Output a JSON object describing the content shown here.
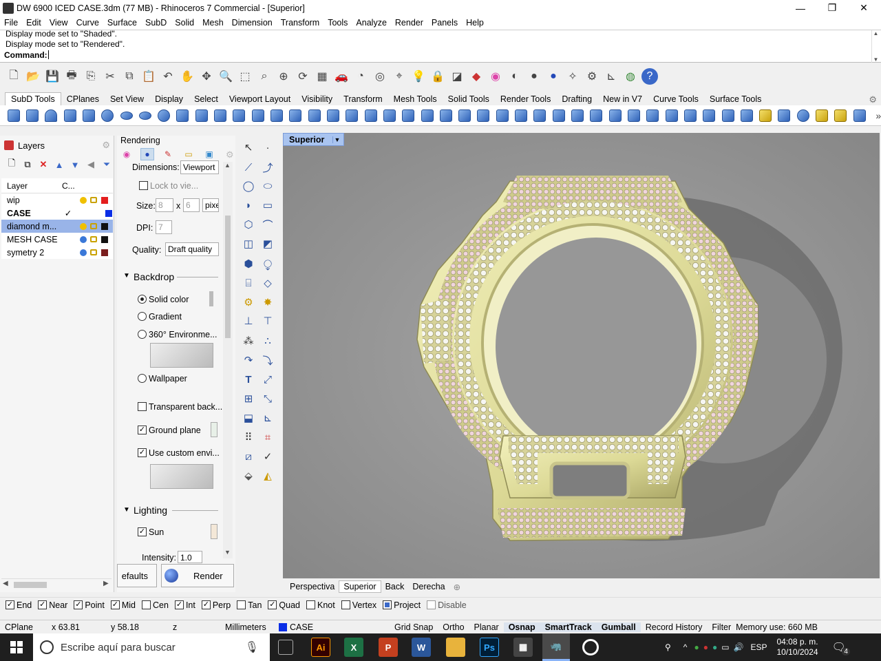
{
  "window": {
    "title": "DW 6900 ICED CASE.3dm (77 MB) - Rhinoceros 7 Commercial - [Superior]",
    "minimize": "—",
    "maximize": "❐",
    "close": "✕"
  },
  "menu": [
    "File",
    "Edit",
    "View",
    "Curve",
    "Surface",
    "SubD",
    "Solid",
    "Mesh",
    "Dimension",
    "Transform",
    "Tools",
    "Analyze",
    "Render",
    "Panels",
    "Help"
  ],
  "command": {
    "history": [
      "Display mode set to \"Shaded\".",
      "Display mode set to \"Rendered\"."
    ],
    "prompt_label": "Command:",
    "value": ""
  },
  "toolbar_tabs": [
    "SubD Tools",
    "CPlanes",
    "Set View",
    "Display",
    "Select",
    "Viewport Layout",
    "Visibility",
    "Transform",
    "Mesh Tools",
    "Solid Tools",
    "Render Tools",
    "Drafting",
    "New in V7",
    "Curve Tools",
    "Surface Tools"
  ],
  "layers": {
    "panel_title": "Layers",
    "col_layer": "Layer",
    "col_current": "C...",
    "rows": [
      {
        "name": "wip",
        "current": "",
        "color": "#e41e1e",
        "bulb": "#f0c000",
        "selected": false,
        "bold": false
      },
      {
        "name": "CASE",
        "current": "✓",
        "color": "#0a2ee6",
        "bulb": "",
        "selected": false,
        "bold": true
      },
      {
        "name": "diamond m...",
        "current": "",
        "color": "#111111",
        "bulb": "#f0c000",
        "selected": true,
        "bold": false
      },
      {
        "name": "MESH CASE",
        "current": "",
        "color": "#111111",
        "bulb": "#3a78d8",
        "selected": false,
        "bold": false
      },
      {
        "name": "symetry 2",
        "current": "",
        "color": "#7a1e1e",
        "bulb": "#3a78d8",
        "selected": false,
        "bold": false
      }
    ]
  },
  "rendering": {
    "panel_title": "Rendering",
    "dimensions_label": "Dimensions:",
    "dimensions_value": "Viewport",
    "lock_label": "Lock to vie...",
    "size_label": "Size:",
    "size_w": "8",
    "size_x": "x",
    "size_h": "6",
    "size_unit": "pixe",
    "dpi_label": "DPI:",
    "dpi_value": "7",
    "quality_label": "Quality:",
    "quality_value": "Draft quality",
    "backdrop_title": "Backdrop",
    "solid_color": "Solid color",
    "gradient": "Gradient",
    "env360": "360° Environme...",
    "wallpaper": "Wallpaper",
    "transparent": "Transparent back...",
    "ground_plane": "Ground plane",
    "use_custom_env": "Use custom envi...",
    "lighting_title": "Lighting",
    "sun": "Sun",
    "intensity_label": "Intensity:",
    "intensity_value": "1.0",
    "defaults_btn": "efaults",
    "render_btn": "Render"
  },
  "viewport": {
    "active_label": "Superior",
    "tabs": [
      "Perspectiva",
      "Superior",
      "Back",
      "Derecha"
    ],
    "add_tab": "⊕",
    "colors": {
      "bg": "#8e8e8e",
      "metal": "#e8e6a8",
      "metal_dark": "#b8b478",
      "shadow": "#6e6e6e",
      "stone_pink": "#f0d4dc",
      "stone_white": "#f4f4f0"
    }
  },
  "osnap": [
    {
      "label": "End",
      "checked": true
    },
    {
      "label": "Near",
      "checked": true
    },
    {
      "label": "Point",
      "checked": true
    },
    {
      "label": "Mid",
      "checked": true
    },
    {
      "label": "Cen",
      "checked": false
    },
    {
      "label": "Int",
      "checked": true
    },
    {
      "label": "Perp",
      "checked": true
    },
    {
      "label": "Tan",
      "checked": false
    },
    {
      "label": "Quad",
      "checked": true
    },
    {
      "label": "Knot",
      "checked": false
    },
    {
      "label": "Vertex",
      "checked": false
    },
    {
      "label": "Project",
      "checked": true,
      "square": true
    },
    {
      "label": "Disable",
      "checked": false,
      "disabled": true
    }
  ],
  "statusbar": {
    "cplane": "CPlane",
    "x": "x 63.81",
    "y": "y 58.18",
    "z": "z",
    "units": "Millimeters",
    "layer": "CASE",
    "layer_color": "#0a2ee6",
    "items": [
      {
        "label": "Grid Snap",
        "bold": false
      },
      {
        "label": "Ortho",
        "bold": false
      },
      {
        "label": "Planar",
        "bold": false
      },
      {
        "label": "Osnap",
        "bold": true
      },
      {
        "label": "SmartTrack",
        "bold": true
      },
      {
        "label": "Gumball",
        "bold": true
      },
      {
        "label": "Record History",
        "bold": false
      },
      {
        "label": "Filter",
        "bold": false
      }
    ],
    "memory": "Memory use: 660 MB"
  },
  "taskbar": {
    "search_placeholder": "Escribe aquí para buscar",
    "lang": "ESP",
    "time": "04:08 p. m.",
    "date": "10/10/2024",
    "notif_count": "4"
  }
}
